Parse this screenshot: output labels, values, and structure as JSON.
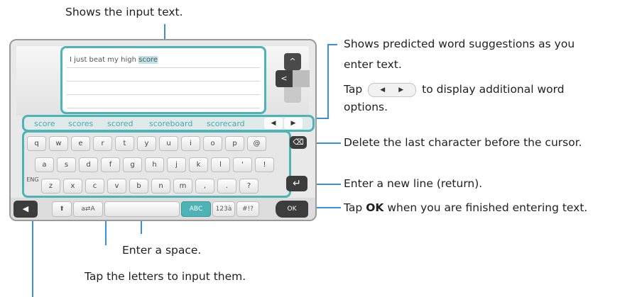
{
  "callouts": {
    "input_text": "Shows the input text.",
    "predicted_1": "Shows predicted word suggestions as you",
    "predicted_2": "enter text.",
    "tap_prefix": "Tap",
    "tap_suffix": "to display additional word",
    "tap_suffix_2": "options.",
    "delete": "Delete the last character before the cursor.",
    "newline": "Enter a new line (return).",
    "ok_prefix": "Tap",
    "ok_bold": "OK",
    "ok_suffix": "when you are finished entering text.",
    "space": "Enter a space.",
    "letters": "Tap the letters to input them."
  },
  "screen": {
    "typed_text": "I just beat my high ",
    "typed_highlight": "score",
    "dpad_up": "^",
    "dpad_left": "<"
  },
  "predictions": {
    "words": [
      "score",
      "scores",
      "scored",
      "scoreboard",
      "scorecard"
    ],
    "prev_arrow": "◀",
    "next_arrow": "▶"
  },
  "keyboard": {
    "row1": [
      "q",
      "w",
      "e",
      "r",
      "t",
      "y",
      "u",
      "i",
      "o",
      "p",
      "@"
    ],
    "row2": [
      "a",
      "s",
      "d",
      "f",
      "g",
      "h",
      "j",
      "k",
      "l",
      "'",
      "!"
    ],
    "row3": [
      "z",
      "x",
      "c",
      "v",
      "b",
      "n",
      "m",
      ",",
      ".",
      "?"
    ],
    "delete_key": "⌫",
    "return_key": "↵",
    "lang_key": "ENG",
    "back_key": "◀",
    "shift_key": "⬆",
    "case_key": "a⇄A",
    "mode_abc": "ABC",
    "mode_123": "123à",
    "mode_sym": "#!?",
    "ok_key": "OK"
  },
  "colors": {
    "accent": "#4db3b5",
    "callout_line": "#3b8fd6"
  }
}
